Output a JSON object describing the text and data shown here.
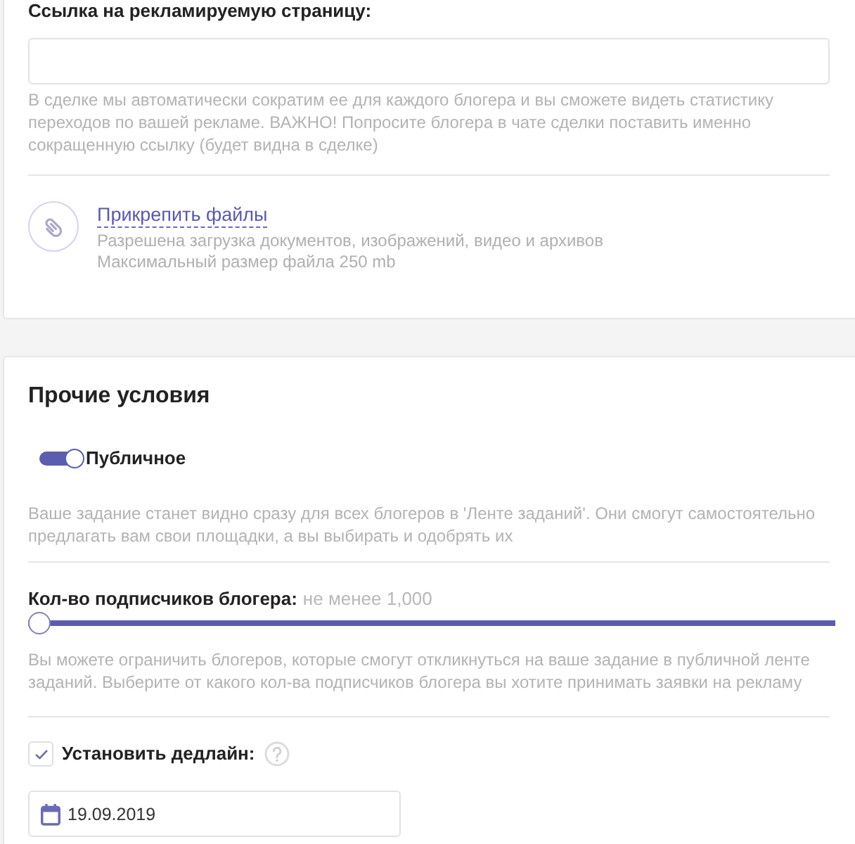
{
  "link_field": {
    "label": "Ссылка на рекламируемую страницу:",
    "hint": "В сделке мы автоматически сократим ее для каждого блогера и вы сможете видеть статистику переходов по вашей рекламе. ВАЖНО! Попросите блогера в чате сделки поставить именно сокращенную ссылку (будет видна в сделке)"
  },
  "attachment": {
    "link": "Прикрепить файлы",
    "notes": [
      "Разрешена загрузка документов, изображений, видео и архивов",
      "Максимальный размер файла 250 mb"
    ]
  },
  "other_conditions": {
    "title": "Прочие условия",
    "visibility": {
      "label": "Публичное",
      "on": true,
      "hint": "Ваше задание станет видно сразу для всех блогеров в 'Ленте заданий'. Они смогут самостоятельно предлагать вам свои площадки, а вы выбирать и одобрять их"
    },
    "subscribers": {
      "label": "Кол-во подписчиков блогера:",
      "value": "не менее 1,000",
      "level": 0,
      "hint": "Вы можете ограничить блогеров, которые смогут откликнуться на ваше задание в публичной ленте заданий. Выберите от какого кол-ва подписчиков блогера вы хотите принимать заявки на рекламу"
    },
    "deadline": {
      "label": "Установить дедлайн:",
      "checked": true,
      "date": "19.09.2019"
    }
  }
}
